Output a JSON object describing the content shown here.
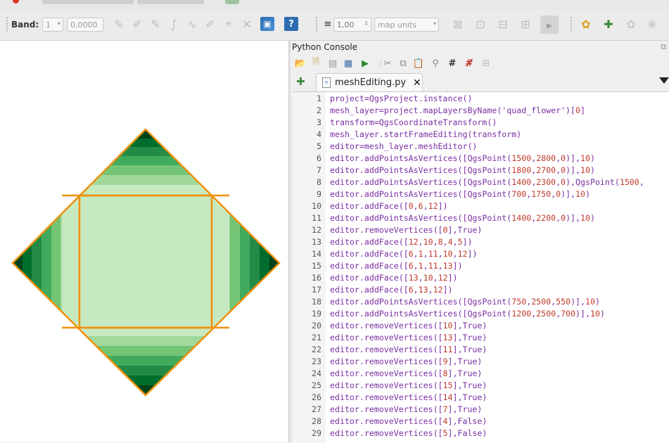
{
  "band_toolbar": {
    "band_label": "Band:",
    "band_value": "1",
    "value_field": "0,0000",
    "width_value": "1,00",
    "unit_value": "map units"
  },
  "console": {
    "title": "Python Console",
    "tab_label": "meshEditing.py",
    "tab_close": "✕",
    "lines": [
      {
        "n": "1",
        "t": "project=QgsProject.instance()"
      },
      {
        "n": "2",
        "t": "mesh_layer=project.mapLayersByName('quad_flower')[0]"
      },
      {
        "n": "3",
        "t": "transform=QgsCoordinateTransform()"
      },
      {
        "n": "4",
        "t": "mesh_layer.startFrameEditing(transform)"
      },
      {
        "n": "5",
        "t": "editor=mesh_layer.meshEditor()"
      },
      {
        "n": "6",
        "t": "editor.addPointsAsVertices([QgsPoint(1500,2800,0)],10)"
      },
      {
        "n": "7",
        "t": "editor.addPointsAsVertices([QgsPoint(1800,2700,0)],10)"
      },
      {
        "n": "8",
        "t": "editor.addPointsAsVertices([QgsPoint(1400,2300,0),QgsPoint(1500,"
      },
      {
        "n": "9",
        "t": "editor.addPointsAsVertices([QgsPoint(700,1750,0)],10)"
      },
      {
        "n": "10",
        "t": "editor.addFace([0,6,12])"
      },
      {
        "n": "11",
        "t": "editor.addPointsAsVertices([QgsPoint(1400,2200,0)],10)"
      },
      {
        "n": "12",
        "t": "editor.removeVertices([0],True)"
      },
      {
        "n": "13",
        "t": "editor.addFace([12,10,8,4,5])"
      },
      {
        "n": "14",
        "t": "editor.addFace([6,1,11,10,12])"
      },
      {
        "n": "15",
        "t": "editor.addFace([6,1,11,13])"
      },
      {
        "n": "16",
        "t": "editor.addFace([13,10,12])"
      },
      {
        "n": "17",
        "t": "editor.addFace([6,13,12])"
      },
      {
        "n": "18",
        "t": "editor.addPointsAsVertices([QgsPoint(750,2500,550)],10)"
      },
      {
        "n": "19",
        "t": "editor.addPointsAsVertices([QgsPoint(1200,2500,700)],10)"
      },
      {
        "n": "20",
        "t": "editor.removeVertices([10],True)"
      },
      {
        "n": "21",
        "t": "editor.removeVertices([13],True)"
      },
      {
        "n": "22",
        "t": "editor.removeVertices([11],True)"
      },
      {
        "n": "23",
        "t": "editor.removeVertices([9],True)"
      },
      {
        "n": "24",
        "t": "editor.removeVertices([8],True)"
      },
      {
        "n": "25",
        "t": "editor.removeVertices([15],True)"
      },
      {
        "n": "26",
        "t": "editor.removeVertices([14],True)"
      },
      {
        "n": "27",
        "t": "editor.removeVertices([7],True)"
      },
      {
        "n": "28",
        "t": "editor.removeVertices([4],False)"
      },
      {
        "n": "29",
        "t": "editor.removeVertices([5],False)"
      }
    ]
  },
  "colors": {
    "mesh_edge": "#f0900a",
    "green_dark": "#00441b",
    "green_light": "#c7e9c0",
    "code_purple": "#7b2ea3",
    "number_red": "#c0392b"
  }
}
